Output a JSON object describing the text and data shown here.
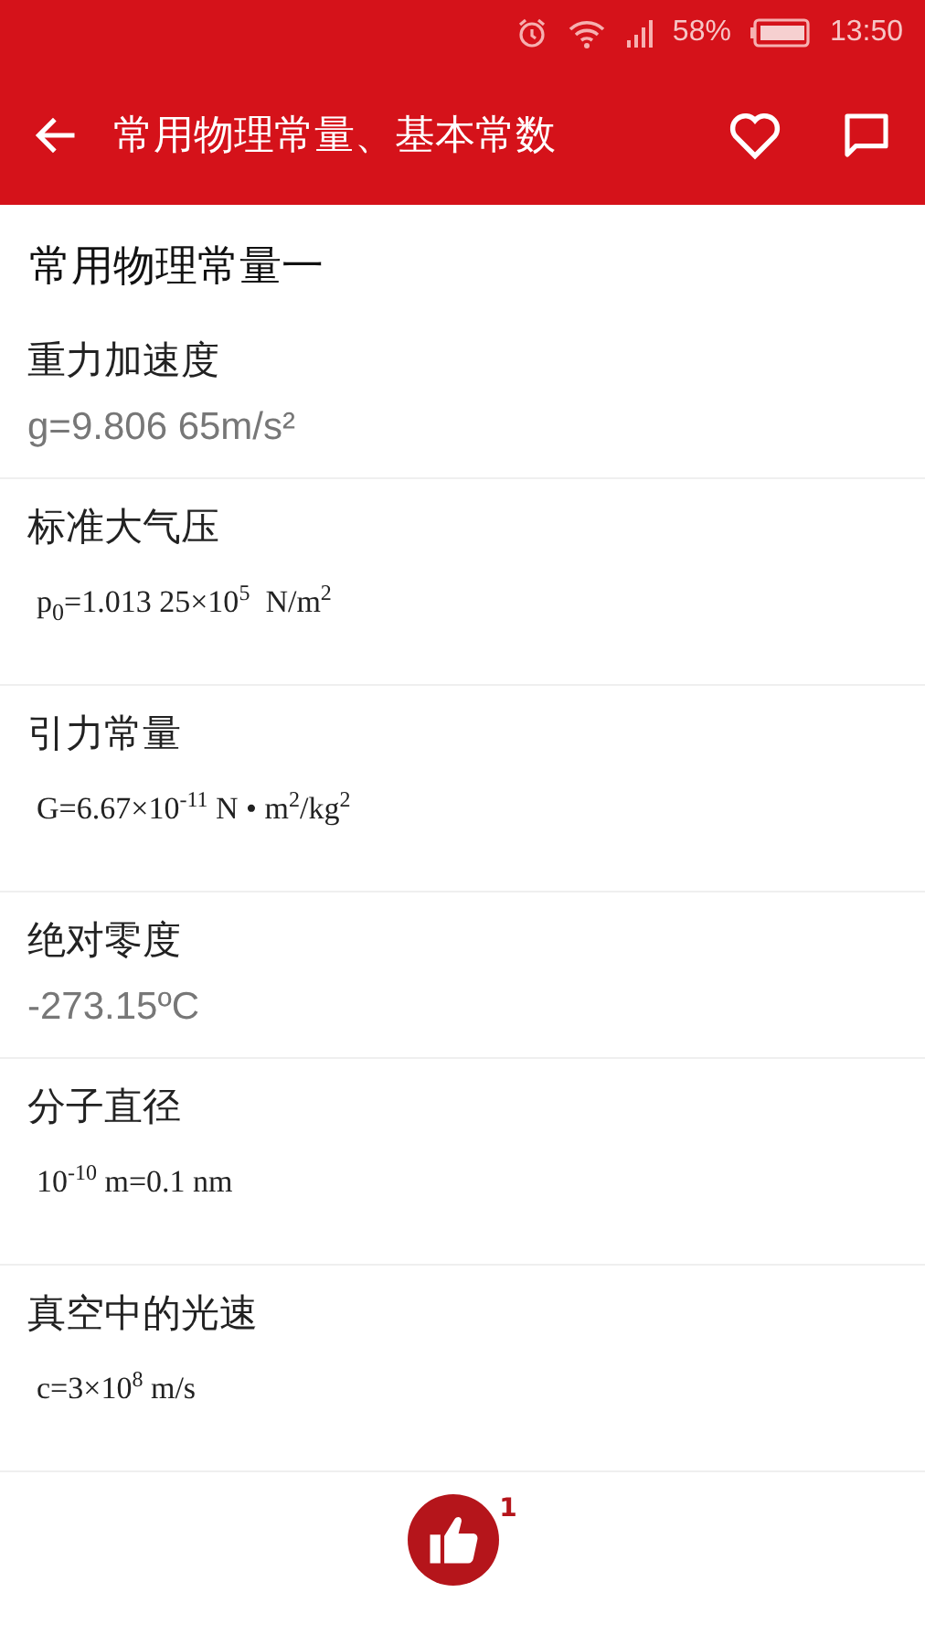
{
  "status_bar": {
    "battery_text": "58%",
    "time": "13:50"
  },
  "toolbar": {
    "title": "常用物理常量、基本常数"
  },
  "section_title": "常用物理常量一",
  "items": [
    {
      "name": "重力加速度",
      "kind": "sans",
      "value": "g=9.806 65m/s²"
    },
    {
      "name": "标准大气压",
      "kind": "serif",
      "value": "p$_{0}$=1.013 25×10$^{5}$  N/m$^{2}$"
    },
    {
      "name": "引力常量",
      "kind": "serif",
      "value": "G=6.67×10$^{-11}$ N • m$^{2}$/kg$^{2}$"
    },
    {
      "name": "绝对零度",
      "kind": "sans",
      "value": "-273.15ºC"
    },
    {
      "name": "分子直径",
      "kind": "serif",
      "value": "10$^{-10}$ m=0.1 nm"
    },
    {
      "name": "真空中的光速",
      "kind": "serif",
      "value": "c=3×10$^{8}$ m/s"
    }
  ],
  "like": {
    "count": "1"
  }
}
